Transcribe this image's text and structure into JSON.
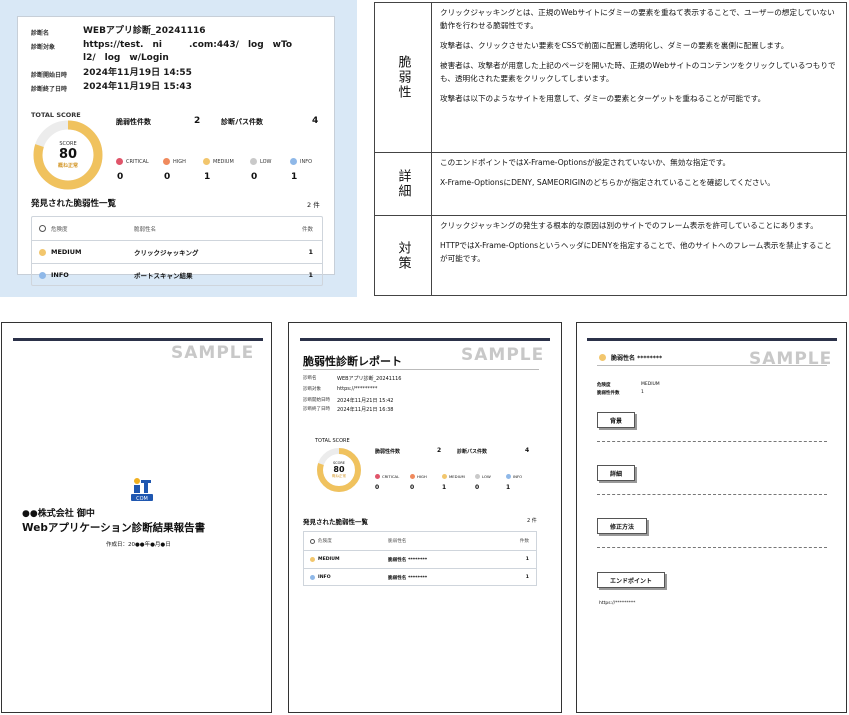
{
  "summary": {
    "diag_name_key": "診断名",
    "diag_name": "WEBアプリ診断_20241116",
    "target_key": "診断対象",
    "target_line1": "https://test.　ni　　　.com:443/　log　wTo",
    "target_line2": "l2/　log　w/Login",
    "start_key": "診断開始日時",
    "start": "2024年11月19日 14:55",
    "end_key": "診断終了日時",
    "end": "2024年11月19日 15:43",
    "total_score_label": "TOTAL SCORE",
    "score_label": "SCORE",
    "score": "80",
    "score_status": "概ね正常",
    "score_fraction": 0.8,
    "vuln_count_label": "脆弱性件数",
    "vuln_count": "2",
    "pass_count_label": "診断パス件数",
    "pass_count": "4",
    "severities": [
      {
        "label": "CRITICAL",
        "value": "0",
        "color": "#e0556a"
      },
      {
        "label": "HIGH",
        "value": "0",
        "color": "#f08a5d"
      },
      {
        "label": "MEDIUM",
        "value": "1",
        "color": "#f2c66d"
      },
      {
        "label": "LOW",
        "value": "0",
        "color": "#c9c9c9"
      },
      {
        "label": "INFO",
        "value": "1",
        "color": "#8fb8e8"
      }
    ],
    "list_title": "発見された脆弱性一覧",
    "list_count": "2 件",
    "table_head": {
      "sev": "危険度",
      "name": "脆弱性名",
      "count": "件数"
    },
    "rows": [
      {
        "sev": "MEDIUM",
        "name": "クリックジャッキング",
        "count": "1",
        "color": "#f2c66d"
      },
      {
        "sev": "INFO",
        "name": "ポートスキャン結果",
        "count": "1",
        "color": "#8fb8e8"
      }
    ]
  },
  "desc": {
    "vuln_head": "脆弱性",
    "vuln_p1": "クリックジャッキングとは、正規のWebサイトにダミーの要素を重ねて表示することで、ユーザーの想定していない動作を行わせる脆弱性です。",
    "vuln_p2": "攻撃者は、クリックさせたい要素をCSSで前面に配置し透明化し、ダミーの要素を裏側に配置します。",
    "vuln_p3": "被害者は、攻撃者が用意した上記のページを開いた時、正規のWebサイトのコンテンツをクリックしているつもりでも、透明化された要素をクリックしてしまいます。",
    "vuln_p4": "攻撃者は以下のようなサイトを用意して、ダミーの要素とターゲットを重ねることが可能です。",
    "detail_head": "詳細",
    "detail_p1": "このエンドポイントではX-Frame-Optionsが設定されていないか、無効な指定です。",
    "detail_p2": "X-Frame-OptionsにDENY, SAMEORIGINのどちらかが指定されていることを確認してください。",
    "fix_head": "対策",
    "fix_p1": "クリックジャッキングの発生する根本的な原因は別のサイトでのフレーム表示を許可していることにあります。",
    "fix_p2": "HTTPではX-Frame-OptionsというヘッダにDENYを指定することで、他のサイトへのフレーム表示を禁止することが可能です。"
  },
  "page1": {
    "company": "●●株式会社 御中",
    "title": "Webアプリケーション診断結果報告書",
    "date": "作成日：20●●年●月●日"
  },
  "page2": {
    "watermark": "SAMPLE",
    "title": "脆弱性診断レポート",
    "meta": [
      {
        "k": "診断名",
        "v": "WEBアプリ診断_20241116"
      },
      {
        "k": "診断対象",
        "v": "https://*********"
      },
      {
        "k": "診断開始日時",
        "v": "2024年11月21日 15:42"
      },
      {
        "k": "診断終了日時",
        "v": "2024年11月21日 16:38"
      }
    ],
    "total_score_label": "TOTAL SCORE",
    "score_label": "SCORE",
    "score": "80",
    "score_status": "概ね正常",
    "vuln_count_label": "脆弱性件数",
    "vuln_count": "2",
    "pass_count_label": "診断パス件数",
    "pass_count": "4",
    "list_title": "発見された脆弱性一覧",
    "list_count": "2 件",
    "table_head": {
      "sev": "危険度",
      "name": "脆弱性名",
      "count": "件数"
    },
    "rows": [
      {
        "sev": "MEDIUM",
        "name": "脆弱性名 ********",
        "count": "1"
      },
      {
        "sev": "INFO",
        "name": "脆弱性名 ********",
        "count": "1"
      }
    ]
  },
  "page3": {
    "watermark": "SAMPLE",
    "head": "脆弱性名 ********",
    "kv": [
      {
        "k": "危険度",
        "v": "MEDIUM"
      },
      {
        "k": "脆弱性件数",
        "v": "1"
      }
    ],
    "btn_background": "背景",
    "btn_detail": "詳細",
    "btn_fix": "修正方法",
    "btn_endpoint": "エンドポイント",
    "url": "https://*********"
  }
}
